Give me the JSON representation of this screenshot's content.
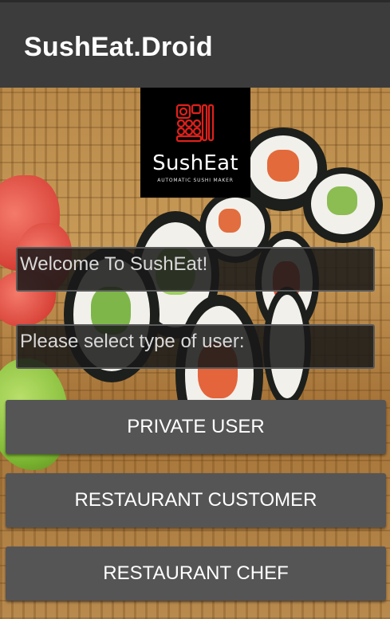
{
  "app_bar": {
    "title": "SushEat.Droid"
  },
  "logo": {
    "name": "SushEat",
    "tagline": "AUTOMATIC SUSHI MAKER"
  },
  "fields": {
    "welcome": "Welcome To SushEat!",
    "prompt": "Please select type of user:"
  },
  "buttons": {
    "private_user": "PRIVATE USER",
    "restaurant_customer": "RESTAURANT CUSTOMER",
    "restaurant_chef": "RESTAURANT CHEF"
  },
  "colors": {
    "app_bar": "#3c3c3c",
    "button": "#555556",
    "logo_accent": "#e0201a"
  }
}
